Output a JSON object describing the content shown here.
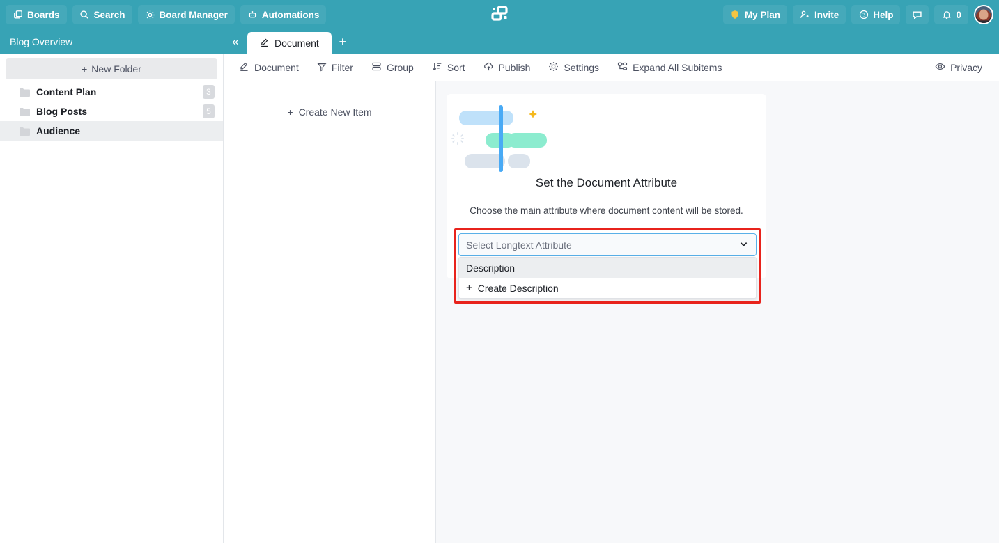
{
  "topbar": {
    "left_buttons": [
      {
        "label": "Boards",
        "icon": "boards-icon"
      },
      {
        "label": "Search",
        "icon": "search-icon"
      },
      {
        "label": "Board Manager",
        "icon": "gear-icon"
      },
      {
        "label": "Automations",
        "icon": "robot-icon"
      }
    ],
    "logo": "app-logo",
    "right_buttons": [
      {
        "label": "My Plan",
        "icon": "shield-icon"
      },
      {
        "label": "Invite",
        "icon": "user-plus-icon"
      },
      {
        "label": "Help",
        "icon": "question-circle-icon"
      }
    ],
    "chat_icon": "chat-bubble-icon",
    "notification_icon": "bell-icon",
    "notification_count": "0",
    "avatar": "user-avatar",
    "accent_color": "#37A3B5",
    "button_color": "#45A9BA"
  },
  "sidebar": {
    "title": "Blog Overview",
    "new_folder_label": "New Folder",
    "folders": [
      {
        "name": "Content Plan",
        "count": "3",
        "selected": false
      },
      {
        "name": "Blog Posts",
        "count": "5",
        "selected": false
      },
      {
        "name": "Audience",
        "count": "",
        "selected": true
      }
    ]
  },
  "tabstrip": {
    "collapse_label": "«",
    "tabs": [
      {
        "label": "Document",
        "icon": "pen-underline-icon",
        "active": true
      }
    ],
    "add_tab_label": "+"
  },
  "toolbar": {
    "items": [
      {
        "label": "Document",
        "icon": "pen-underline-icon"
      },
      {
        "label": "Filter",
        "icon": "funnel-icon"
      },
      {
        "label": "Group",
        "icon": "group-rows-icon"
      },
      {
        "label": "Sort",
        "icon": "sort-arrow-icon"
      },
      {
        "label": "Publish",
        "icon": "cloud-upload-icon"
      },
      {
        "label": "Settings",
        "icon": "gear-icon"
      },
      {
        "label": "Expand All Subitems",
        "icon": "hierarchy-icon"
      }
    ],
    "privacy": {
      "label": "Privacy",
      "icon": "eye-icon"
    }
  },
  "list_pane": {
    "create_new_label": "Create New Item"
  },
  "document_card": {
    "illustration": "document-attribute-illustration",
    "title": "Set the Document Attribute",
    "subtitle": "Choose the main attribute where document content will be stored.",
    "select": {
      "placeholder": "Select Longtext Attribute",
      "value": "",
      "chevron": "chevron-down-icon",
      "options": [
        {
          "label": "Description",
          "highlighted": true,
          "is_create": false
        },
        {
          "label": "Create Description",
          "highlighted": false,
          "is_create": true
        }
      ]
    },
    "highlight_color": "#e8231c"
  }
}
